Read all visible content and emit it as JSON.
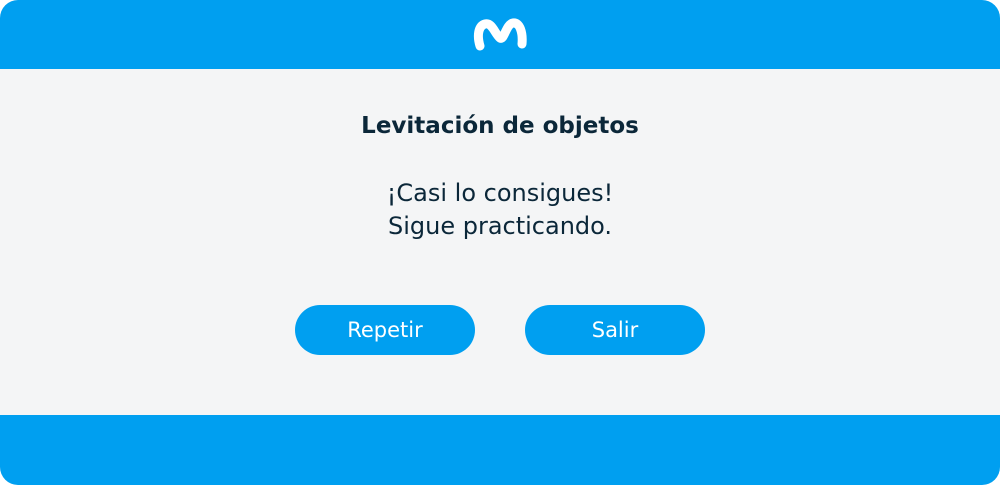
{
  "brand": {
    "logo_icon": "movistar-m-logo-icon",
    "primary_color": "#009ff0",
    "background_color": "#f4f5f6",
    "text_color": "#0b2739"
  },
  "dialog": {
    "title": "Levitación de objetos",
    "message_line_1": "¡Casi lo consigues!",
    "message_line_2": "Sigue practicando."
  },
  "actions": {
    "repeat_label": "Repetir",
    "exit_label": "Salir"
  }
}
